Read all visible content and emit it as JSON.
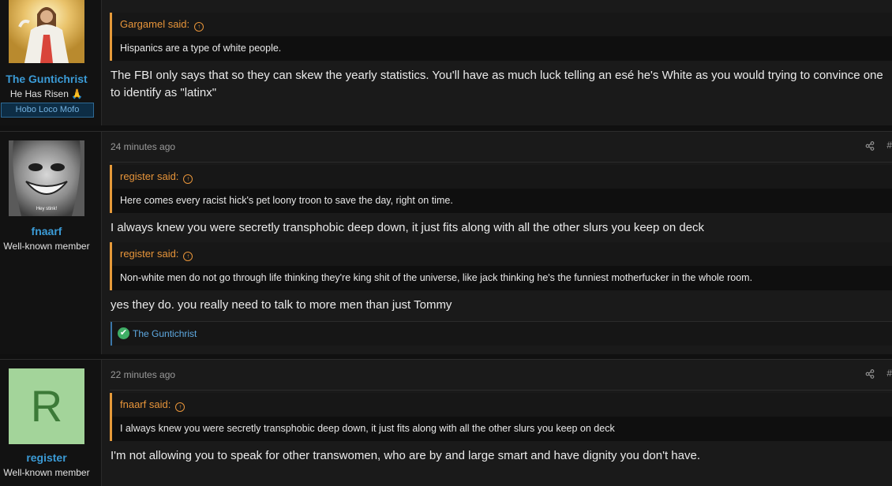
{
  "posts": [
    {
      "username": "The Guntichrist",
      "user_title": "He Has Risen 🙏",
      "user_banner": "Hobo Loco Mofo",
      "quotes": [
        {
          "author": "Gargamel said:",
          "text": "Hispanics are a type of white people."
        }
      ],
      "messages": [
        "The FBI only says that so they can skew the yearly statistics. You'll have as much luck telling an esé he's White as you would trying to convince one to identify as \"latinx\""
      ]
    },
    {
      "username": "fnaarf",
      "user_title": "Well-known member",
      "avatar_caption": "Hey stink!",
      "time": "24 minutes ago",
      "post_number": "#",
      "quotes": [
        {
          "author": "register said:",
          "text": "Here comes every racist hick's pet loony troon to save the day, right on time."
        },
        {
          "author": "register said:",
          "text": "Non-white men do not go through life thinking they're king shit of the universe, like jack thinking he's the funniest motherfucker in the whole room."
        }
      ],
      "messages": [
        "I always knew you were secretly transphobic deep down, it just fits along with all the other slurs you keep on deck",
        "yes they do. you really need to talk to more men than just Tommy"
      ],
      "reaction_users": "The Guntichrist"
    },
    {
      "username": "register",
      "user_title": "Well-known member",
      "avatar_letter": "R",
      "time": "22 minutes ago",
      "post_number": "#",
      "quotes": [
        {
          "author": "fnaarf said:",
          "text": "I always knew you were secretly transphobic deep down, it just fits along with all the other slurs you keep on deck"
        }
      ],
      "messages": [
        "I'm not allowing you to speak for other transwomen, who are by and large smart and have dignity you don't have."
      ]
    }
  ],
  "colors": {
    "username": "#3b9bd6",
    "quote_accent": "#e69a3a",
    "reaction_check": "#3fae66",
    "register_avatar_bg": "#a3d49a",
    "register_avatar_fg": "#3c7a38"
  }
}
